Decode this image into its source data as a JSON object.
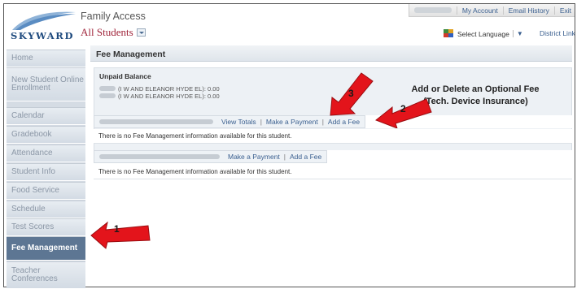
{
  "header": {
    "logo_text": "SKYWARD",
    "app_title": "Family Access",
    "student_selector": "All Students",
    "topbar": {
      "my_account": "My Account",
      "email_history": "Email History",
      "exit": "Exit"
    },
    "language": "Select Language",
    "language_arrow": "▼",
    "district_links": "District Links"
  },
  "sidebar": {
    "items": [
      {
        "label": "Home"
      },
      {
        "label": "New Student Online Enrollment"
      },
      {
        "label": "Calendar"
      },
      {
        "label": "Gradebook"
      },
      {
        "label": "Attendance"
      },
      {
        "label": "Student Info"
      },
      {
        "label": "Food Service"
      },
      {
        "label": "Schedule"
      },
      {
        "label": "Test Scores"
      },
      {
        "label": "Fee Management"
      },
      {
        "label": "Teacher Conferences"
      }
    ],
    "active_index": 9
  },
  "main": {
    "page_title": "Fee Management",
    "unpaid": {
      "label": "Unpaid Balance",
      "lines": [
        {
          "school": "(I W AND ELEANOR HYDE EL):",
          "amount": "0.00"
        },
        {
          "school": "(I W AND ELEANOR HYDE EL):",
          "amount": "0.00"
        }
      ]
    },
    "students": [
      {
        "links": [
          "View Totals",
          "Make a Payment",
          "Add a Fee"
        ],
        "message": "There is no Fee Management information available for this student."
      },
      {
        "links": [
          "Make a Payment",
          "Add a Fee"
        ],
        "message": "There is no Fee Management information available for this student."
      }
    ]
  },
  "annotation": {
    "line1": "Add or Delete an Optional Fee",
    "line2": "(Tech. Device Insurance)"
  },
  "callouts": [
    "1",
    "2",
    "3"
  ],
  "colors": {
    "accent": "#3a5f8f",
    "student_selector": "#a0243a",
    "active_nav": "#5d7693",
    "arrow": "#e3141b"
  }
}
